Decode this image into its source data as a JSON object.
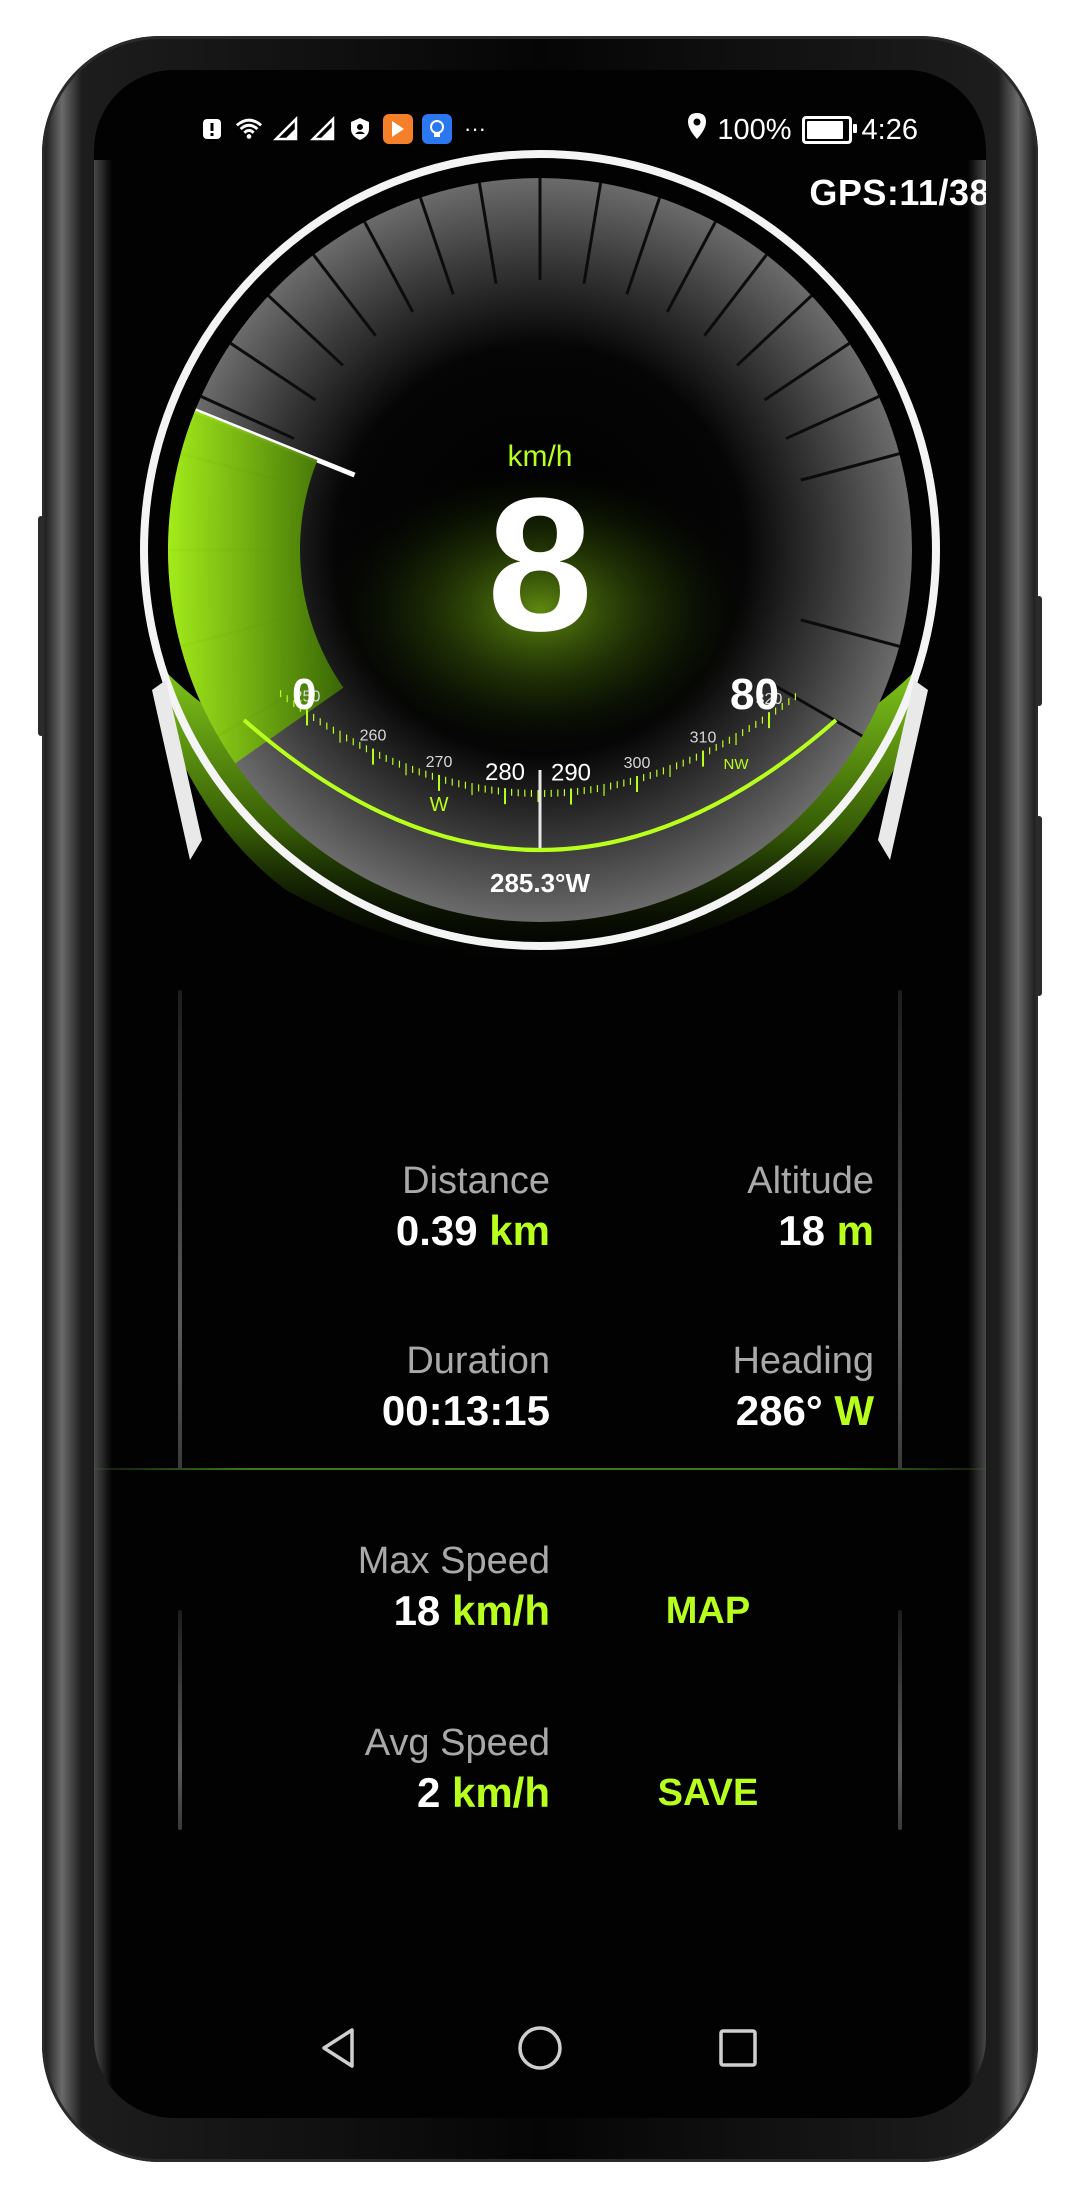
{
  "status_bar": {
    "left_icons": [
      "alert-icon",
      "wifi-icon",
      "signal-icon-1",
      "signal-icon-2",
      "shield-icon",
      "orange-app-icon",
      "blue-app-icon",
      "more-icon"
    ],
    "more": "···",
    "battery": "100%",
    "time": "4:26",
    "battery_level": 1.0
  },
  "gps": {
    "label": "GPS:11/38"
  },
  "gauge": {
    "unit": "km/h",
    "speed": "8",
    "min": "0",
    "max": "80",
    "speed_value": 8,
    "speed_max": 80,
    "accent_color": "#b8ff1e"
  },
  "compass": {
    "ticks": [
      "250",
      "260",
      "270",
      "280",
      "290",
      "300",
      "310",
      "320"
    ],
    "cardinals": [
      {
        "at": "270",
        "label": "W"
      },
      {
        "at": "315",
        "label": "NW"
      }
    ],
    "heading_value": 285.3,
    "heading_readout": "285.3°W"
  },
  "stats": {
    "distance": {
      "label": "Distance",
      "value": "0.39",
      "unit": "km"
    },
    "altitude": {
      "label": "Altitude",
      "value": "18",
      "unit": "m"
    },
    "duration": {
      "label": "Duration",
      "value": "00:13:15"
    },
    "heading": {
      "label": "Heading",
      "value": "286°",
      "unit": "W"
    },
    "max_speed": {
      "label": "Max Speed",
      "value": "18",
      "unit": "km/h"
    },
    "avg_speed": {
      "label": "Avg Speed",
      "value": "2",
      "unit": "km/h"
    }
  },
  "actions": {
    "map": "MAP",
    "save": "SAVE"
  },
  "navbar": [
    "back-icon",
    "home-icon",
    "recents-icon"
  ]
}
